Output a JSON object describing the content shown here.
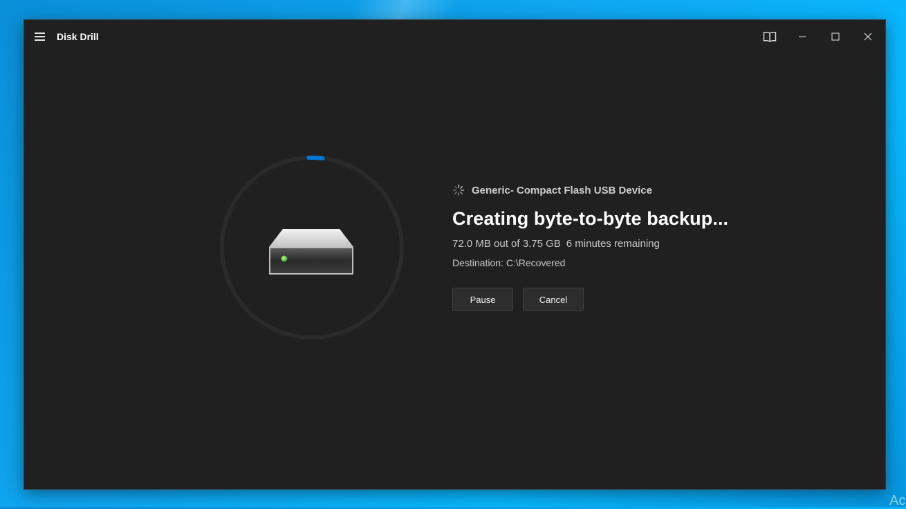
{
  "app": {
    "title": "Disk Drill"
  },
  "titlebar": {
    "icons": [
      "hamburger-menu-icon",
      "book-icon",
      "minimize-icon",
      "maximize-icon",
      "close-icon"
    ]
  },
  "backup": {
    "device_name": "Generic- Compact Flash USB Device",
    "status_title": "Creating byte-to-byte backup...",
    "progress_text": "72.0 MB out of 3.75 GB",
    "time_remaining": "6 minutes remaining",
    "destination": "Destination: C:\\Recovered",
    "progress_fraction": 0.019
  },
  "actions": {
    "pause_label": "Pause",
    "cancel_label": "Cancel"
  },
  "colors": {
    "accent": "#0078d7",
    "window_bg": "#202020",
    "ring_track": "#2b2b2b"
  },
  "desktop": {
    "watermark_text": "Ac"
  }
}
